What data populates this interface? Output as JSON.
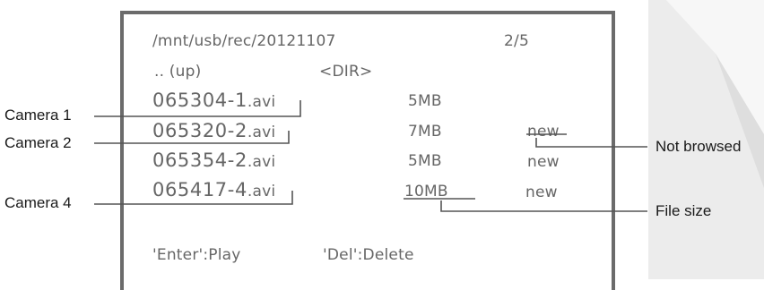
{
  "screen": {
    "path": "/mnt/usb/rec/20121107",
    "page": "2/5",
    "up_entry": ".. (up)",
    "up_type": "<DIR>",
    "files": [
      {
        "name_prefix": "065304-",
        "camera_digit": "1",
        "ext": ".avi",
        "size": "5MB",
        "status": ""
      },
      {
        "name_prefix": "065320-",
        "camera_digit": "2",
        "ext": ".avi",
        "size": "7MB",
        "status": "new"
      },
      {
        "name_prefix": "065354-",
        "camera_digit": "2",
        "ext": ".avi",
        "size": "5MB",
        "status": "new"
      },
      {
        "name_prefix": "065417-",
        "camera_digit": "4",
        "ext": ".avi",
        "size": "10MB",
        "status": "new"
      }
    ],
    "hint_play": "'Enter':Play",
    "hint_delete": "'Del':Delete"
  },
  "callouts": {
    "camera1": "Camera 1",
    "camera2": "Camera 2",
    "camera4": "Camera 4",
    "not_browsed": "Not browsed",
    "file_size": "File size"
  },
  "colors": {
    "screen_border": "#6b6b6b",
    "screen_text": "#666666",
    "callout_line": "#555555",
    "background_stripe": "#ececec"
  }
}
